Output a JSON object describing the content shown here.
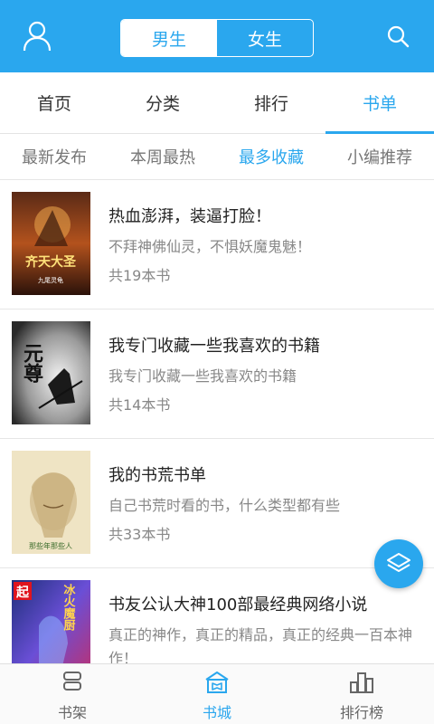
{
  "colors": {
    "accent": "#2aa7ee",
    "text": "#222222",
    "muted": "#888888"
  },
  "header": {
    "user_icon": "user-icon",
    "search_icon": "search-icon",
    "gender_tabs": [
      {
        "label": "男生",
        "active": true
      },
      {
        "label": "女生",
        "active": false
      }
    ]
  },
  "main_tabs": [
    {
      "label": "首页",
      "active": false
    },
    {
      "label": "分类",
      "active": false
    },
    {
      "label": "排行",
      "active": false
    },
    {
      "label": "书单",
      "active": true
    }
  ],
  "sub_tabs": [
    {
      "label": "最新发布",
      "active": false
    },
    {
      "label": "本周最热",
      "active": false
    },
    {
      "label": "最多收藏",
      "active": true
    },
    {
      "label": "小编推荐",
      "active": false
    }
  ],
  "booklists": [
    {
      "title": "热血澎湃，装逼打脸！",
      "desc": "不拜神佛仙灵，不惧妖魔鬼魅！",
      "count": "共19本书",
      "cover_text": "齐天大圣",
      "cover_sub": "九尾灵龟"
    },
    {
      "title": "我专门收藏一些我喜欢的书籍",
      "desc": "我专门收藏一些我喜欢的书籍",
      "count": "共14本书",
      "cover_text": "元尊"
    },
    {
      "title": "我的书荒书单",
      "desc": "自己书荒时看的书，什么类型都有些",
      "count": "共33本书",
      "cover_text": "那些年那些人"
    },
    {
      "title": "书友公认大神100部最经典网络小说",
      "desc": "真正的神作，真正的精品，真正的经典一百本神作！",
      "count": "",
      "cover_text": "冰火魔厨",
      "cover_badge": "起"
    }
  ],
  "fab_icon": "layers-icon",
  "bottom_tabs": [
    {
      "label": "书架",
      "icon": "bookshelf-icon",
      "active": false
    },
    {
      "label": "书城",
      "icon": "bookstore-icon",
      "active": true
    },
    {
      "label": "排行榜",
      "icon": "ranking-icon",
      "active": false
    }
  ]
}
